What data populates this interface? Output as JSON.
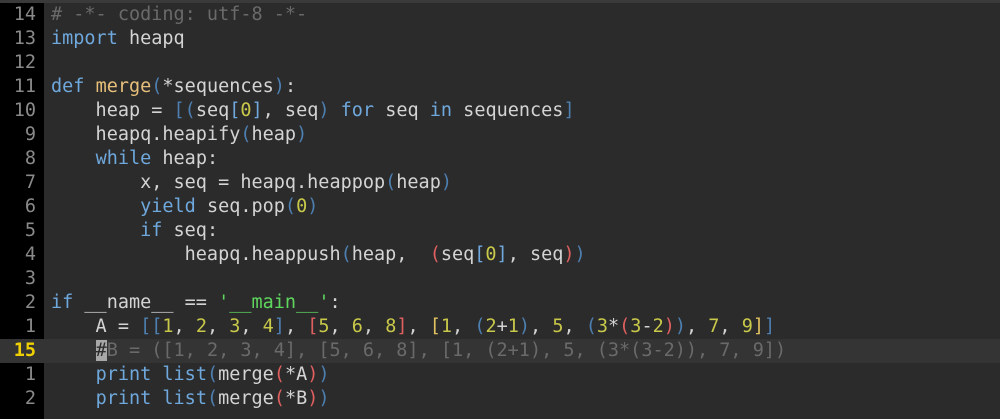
{
  "editor": {
    "lines": [
      {
        "num": "14",
        "tokens": [
          {
            "t": "# -*- coding: utf-8 -*-",
            "c": "cm"
          }
        ]
      },
      {
        "num": "13",
        "tokens": [
          {
            "t": "import",
            "c": "kw"
          },
          {
            "t": " heapq",
            "c": "tx"
          }
        ]
      },
      {
        "num": "12",
        "tokens": []
      },
      {
        "num": "11",
        "tokens": [
          {
            "t": "def",
            "c": "kw"
          },
          {
            "t": " ",
            "c": "tx"
          },
          {
            "t": "merge",
            "c": "fn"
          },
          {
            "t": "(",
            "c": "br"
          },
          {
            "t": "*sequences",
            "c": "tx"
          },
          {
            "t": ")",
            "c": "br"
          },
          {
            "t": ":",
            "c": "tx"
          }
        ]
      },
      {
        "num": "10",
        "tokens": [
          {
            "t": "    heap = ",
            "c": "tx"
          },
          {
            "t": "[(",
            "c": "br"
          },
          {
            "t": "seq",
            "c": "tx"
          },
          {
            "t": "[",
            "c": "p-blue"
          },
          {
            "t": "0",
            "c": "num"
          },
          {
            "t": "]",
            "c": "p-blue"
          },
          {
            "t": ", seq",
            "c": "tx"
          },
          {
            "t": ")",
            "c": "br"
          },
          {
            "t": " ",
            "c": "tx"
          },
          {
            "t": "for",
            "c": "kw"
          },
          {
            "t": " seq ",
            "c": "tx"
          },
          {
            "t": "in",
            "c": "kw"
          },
          {
            "t": " sequences",
            "c": "tx"
          },
          {
            "t": "]",
            "c": "br"
          }
        ]
      },
      {
        "num": "9",
        "tokens": [
          {
            "t": "    heapq.heapify",
            "c": "tx"
          },
          {
            "t": "(",
            "c": "br"
          },
          {
            "t": "heap",
            "c": "tx"
          },
          {
            "t": ")",
            "c": "br"
          }
        ]
      },
      {
        "num": "8",
        "tokens": [
          {
            "t": "    ",
            "c": "tx"
          },
          {
            "t": "while",
            "c": "kw"
          },
          {
            "t": " heap:",
            "c": "tx"
          }
        ]
      },
      {
        "num": "7",
        "tokens": [
          {
            "t": "        x, seq = heapq.heappop",
            "c": "tx"
          },
          {
            "t": "(",
            "c": "br"
          },
          {
            "t": "heap",
            "c": "tx"
          },
          {
            "t": ")",
            "c": "br"
          }
        ]
      },
      {
        "num": "6",
        "tokens": [
          {
            "t": "        ",
            "c": "tx"
          },
          {
            "t": "yield",
            "c": "kw"
          },
          {
            "t": " seq.pop",
            "c": "tx"
          },
          {
            "t": "(",
            "c": "br"
          },
          {
            "t": "0",
            "c": "num"
          },
          {
            "t": ")",
            "c": "br"
          }
        ]
      },
      {
        "num": "5",
        "tokens": [
          {
            "t": "        ",
            "c": "tx"
          },
          {
            "t": "if",
            "c": "kw"
          },
          {
            "t": " seq:",
            "c": "tx"
          }
        ]
      },
      {
        "num": "4",
        "tokens": [
          {
            "t": "            heapq.heappush",
            "c": "tx"
          },
          {
            "t": "(",
            "c": "br"
          },
          {
            "t": "heap,  ",
            "c": "tx"
          },
          {
            "t": "(",
            "c": "p-red"
          },
          {
            "t": "seq",
            "c": "tx"
          },
          {
            "t": "[",
            "c": "p-blue"
          },
          {
            "t": "0",
            "c": "num"
          },
          {
            "t": "]",
            "c": "p-blue"
          },
          {
            "t": ", seq",
            "c": "tx"
          },
          {
            "t": ")",
            "c": "p-red"
          },
          {
            "t": ")",
            "c": "br"
          }
        ]
      },
      {
        "num": "3",
        "tokens": []
      },
      {
        "num": "2",
        "tokens": [
          {
            "t": "if",
            "c": "kw"
          },
          {
            "t": " __name__ == ",
            "c": "tx"
          },
          {
            "t": "'__main__'",
            "c": "st"
          },
          {
            "t": ":",
            "c": "tx"
          }
        ]
      },
      {
        "num": "1",
        "tokens": [
          {
            "t": "    A = ",
            "c": "tx"
          },
          {
            "t": "[[",
            "c": "br"
          },
          {
            "t": "1",
            "c": "num"
          },
          {
            "t": ", ",
            "c": "tx"
          },
          {
            "t": "2",
            "c": "num"
          },
          {
            "t": ", ",
            "c": "tx"
          },
          {
            "t": "3",
            "c": "num"
          },
          {
            "t": ", ",
            "c": "tx"
          },
          {
            "t": "4",
            "c": "num"
          },
          {
            "t": "]",
            "c": "br"
          },
          {
            "t": ", ",
            "c": "tx"
          },
          {
            "t": "[",
            "c": "p-red"
          },
          {
            "t": "5",
            "c": "num"
          },
          {
            "t": ", ",
            "c": "tx"
          },
          {
            "t": "6",
            "c": "num"
          },
          {
            "t": ", ",
            "c": "tx"
          },
          {
            "t": "8",
            "c": "num"
          },
          {
            "t": "]",
            "c": "p-red"
          },
          {
            "t": ", ",
            "c": "tx"
          },
          {
            "t": "[",
            "c": "p-yellow"
          },
          {
            "t": "1",
            "c": "num"
          },
          {
            "t": ", ",
            "c": "tx"
          },
          {
            "t": "(",
            "c": "br"
          },
          {
            "t": "2",
            "c": "num"
          },
          {
            "t": "+",
            "c": "tx"
          },
          {
            "t": "1",
            "c": "num"
          },
          {
            "t": ")",
            "c": "br"
          },
          {
            "t": ", ",
            "c": "tx"
          },
          {
            "t": "5",
            "c": "num"
          },
          {
            "t": ", ",
            "c": "tx"
          },
          {
            "t": "(",
            "c": "br"
          },
          {
            "t": "3",
            "c": "num"
          },
          {
            "t": "*",
            "c": "tx"
          },
          {
            "t": "(",
            "c": "p-red"
          },
          {
            "t": "3",
            "c": "num"
          },
          {
            "t": "-",
            "c": "tx"
          },
          {
            "t": "2",
            "c": "num"
          },
          {
            "t": ")",
            "c": "p-red"
          },
          {
            "t": ")",
            "c": "br"
          },
          {
            "t": ", ",
            "c": "tx"
          },
          {
            "t": "7",
            "c": "num"
          },
          {
            "t": ", ",
            "c": "tx"
          },
          {
            "t": "9",
            "c": "num"
          },
          {
            "t": "]",
            "c": "p-yellow"
          },
          {
            "t": "]",
            "c": "br"
          }
        ]
      },
      {
        "num": "15",
        "current": true,
        "tokens": [
          {
            "t": "    ",
            "c": "tx"
          },
          {
            "t": "#",
            "c": "cursor"
          },
          {
            "t": "B = ([1, 2, 3, 4], [5, 6, 8], [1, (2+1), 5, (3*(3-2)), 7, 9])",
            "c": "dim"
          }
        ]
      },
      {
        "num": "1",
        "tokens": [
          {
            "t": "    ",
            "c": "tx"
          },
          {
            "t": "print",
            "c": "kw"
          },
          {
            "t": " ",
            "c": "tx"
          },
          {
            "t": "list",
            "c": "kw"
          },
          {
            "t": "(",
            "c": "br"
          },
          {
            "t": "merge",
            "c": "tx"
          },
          {
            "t": "(",
            "c": "p-red"
          },
          {
            "t": "*A",
            "c": "tx"
          },
          {
            "t": ")",
            "c": "p-red"
          },
          {
            "t": ")",
            "c": "br"
          }
        ]
      },
      {
        "num": "2",
        "tokens": [
          {
            "t": "    ",
            "c": "tx"
          },
          {
            "t": "print",
            "c": "kw"
          },
          {
            "t": " ",
            "c": "tx"
          },
          {
            "t": "list",
            "c": "kw"
          },
          {
            "t": "(",
            "c": "br"
          },
          {
            "t": "merge",
            "c": "tx"
          },
          {
            "t": "(",
            "c": "p-red"
          },
          {
            "t": "*B",
            "c": "tx"
          },
          {
            "t": ")",
            "c": "p-red"
          },
          {
            "t": ")",
            "c": "br"
          }
        ]
      }
    ]
  }
}
